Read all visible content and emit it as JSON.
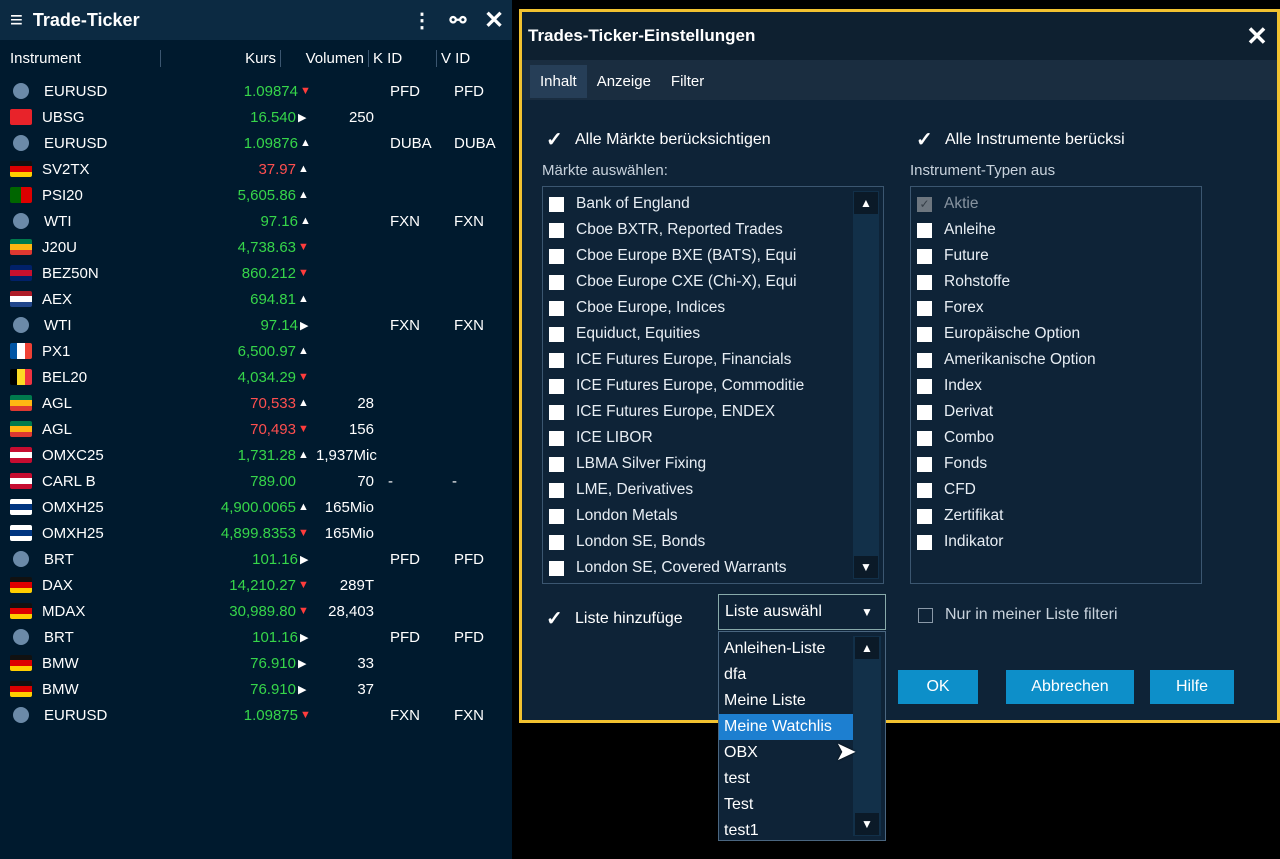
{
  "ticker": {
    "title": "Trade-Ticker",
    "columns": {
      "instrument": "Instrument",
      "kurs": "Kurs",
      "volumen": "Volumen",
      "kid": "K ID",
      "vid": "V ID"
    },
    "rows": [
      {
        "flag": "globe",
        "inst": "EURUSD",
        "kurs": "1.09874",
        "dir": "down",
        "color": "g",
        "vol": "",
        "kid": "PFD",
        "vid": "PFD"
      },
      {
        "flag": "ch",
        "inst": "UBSG",
        "kurs": "16.540",
        "dir": "right",
        "color": "g",
        "vol": "250",
        "kid": "",
        "vid": ""
      },
      {
        "flag": "globe",
        "inst": "EURUSD",
        "kurs": "1.09876",
        "dir": "up",
        "color": "g",
        "vol": "",
        "kid": "DUBA",
        "vid": "DUBA"
      },
      {
        "flag": "de",
        "inst": "SV2TX",
        "kurs": "37.97",
        "dir": "up",
        "color": "r",
        "vol": "",
        "kid": "",
        "vid": ""
      },
      {
        "flag": "pt",
        "inst": "PSI20",
        "kurs": "5,605.86",
        "dir": "up",
        "color": "g",
        "vol": "",
        "kid": "",
        "vid": ""
      },
      {
        "flag": "globe",
        "inst": "WTI",
        "kurs": "97.16",
        "dir": "up",
        "color": "g",
        "vol": "",
        "kid": "FXN",
        "vid": "FXN"
      },
      {
        "flag": "za",
        "inst": "J20U",
        "kurs": "4,738.63",
        "dir": "down",
        "color": "g",
        "vol": "",
        "kid": "",
        "vid": ""
      },
      {
        "flag": "gb",
        "inst": "BEZ50N",
        "kurs": "860.212",
        "dir": "down",
        "color": "g",
        "vol": "",
        "kid": "",
        "vid": ""
      },
      {
        "flag": "nl",
        "inst": "AEX",
        "kurs": "694.81",
        "dir": "up",
        "color": "g",
        "vol": "",
        "kid": "",
        "vid": ""
      },
      {
        "flag": "globe",
        "inst": "WTI",
        "kurs": "97.14",
        "dir": "right",
        "color": "g",
        "vol": "",
        "kid": "FXN",
        "vid": "FXN"
      },
      {
        "flag": "fr",
        "inst": "PX1",
        "kurs": "6,500.97",
        "dir": "up",
        "color": "g",
        "vol": "",
        "kid": "",
        "vid": ""
      },
      {
        "flag": "be",
        "inst": "BEL20",
        "kurs": "4,034.29",
        "dir": "down",
        "color": "g",
        "vol": "",
        "kid": "",
        "vid": ""
      },
      {
        "flag": "za",
        "inst": "AGL",
        "kurs": "70,533",
        "dir": "up",
        "color": "r",
        "vol": "28",
        "kid": "",
        "vid": ""
      },
      {
        "flag": "za",
        "inst": "AGL",
        "kurs": "70,493",
        "dir": "down",
        "color": "r",
        "vol": "156",
        "kid": "",
        "vid": ""
      },
      {
        "flag": "dk",
        "inst": "OMXC25",
        "kurs": "1,731.28",
        "dir": "up",
        "color": "g",
        "vol": "1,937Mic",
        "kid": "",
        "vid": ""
      },
      {
        "flag": "dk",
        "inst": "CARL B",
        "kurs": "789.00",
        "dir": "none",
        "color": "g",
        "vol": "70",
        "kid": "-",
        "vid": "-"
      },
      {
        "flag": "fi",
        "inst": "OMXH25",
        "kurs": "4,900.0065",
        "dir": "up",
        "color": "g",
        "vol": "165Mio",
        "kid": "",
        "vid": ""
      },
      {
        "flag": "fi",
        "inst": "OMXH25",
        "kurs": "4,899.8353",
        "dir": "down",
        "color": "g",
        "vol": "165Mio",
        "kid": "",
        "vid": ""
      },
      {
        "flag": "globe",
        "inst": "BRT",
        "kurs": "101.16",
        "dir": "right",
        "color": "g",
        "vol": "",
        "kid": "PFD",
        "vid": "PFD"
      },
      {
        "flag": "de",
        "inst": "DAX",
        "kurs": "14,210.27",
        "dir": "down",
        "color": "g",
        "vol": "289T",
        "kid": "",
        "vid": ""
      },
      {
        "flag": "de",
        "inst": "MDAX",
        "kurs": "30,989.80",
        "dir": "down",
        "color": "g",
        "vol": "28,403",
        "kid": "",
        "vid": ""
      },
      {
        "flag": "globe",
        "inst": "BRT",
        "kurs": "101.16",
        "dir": "right",
        "color": "g",
        "vol": "",
        "kid": "PFD",
        "vid": "PFD"
      },
      {
        "flag": "de",
        "inst": "BMW",
        "kurs": "76.910",
        "dir": "right",
        "color": "g",
        "vol": "33",
        "kid": "",
        "vid": ""
      },
      {
        "flag": "de",
        "inst": "BMW",
        "kurs": "76.910",
        "dir": "right",
        "color": "g",
        "vol": "37",
        "kid": "",
        "vid": ""
      },
      {
        "flag": "globe",
        "inst": "EURUSD",
        "kurs": "1.09875",
        "dir": "down",
        "color": "g",
        "vol": "",
        "kid": "FXN",
        "vid": "FXN"
      }
    ]
  },
  "dialog": {
    "title": "Trades-Ticker-Einstellungen",
    "tabs": [
      "Inhalt",
      "Anzeige",
      "Filter"
    ],
    "all_markets": "Alle Märkte berücksichtigen",
    "markets_label": "Märkte auswählen:",
    "markets": [
      "Bank of England",
      "Cboe BXTR, Reported Trades",
      "Cboe Europe BXE (BATS), Equi",
      "Cboe Europe CXE (Chi-X), Equi",
      "Cboe Europe, Indices",
      "Equiduct, Equities",
      "ICE Futures Europe,  Financials",
      "ICE Futures Europe, Commoditie",
      "ICE Futures Europe, ENDEX",
      "ICE LIBOR",
      "LBMA Silver Fixing",
      "LME, Derivatives",
      "London Metals",
      "London SE, Bonds",
      "London SE, Covered Warrants"
    ],
    "all_instruments": "Alle Instrumente berücksi",
    "types_label": "Instrument-Typen aus",
    "types": [
      "Aktie",
      "Anleihe",
      "Future",
      "Rohstoffe",
      "Forex",
      "Europäische Option",
      "Amerikanische Option",
      "Index",
      "Derivat",
      "Combo",
      "Fonds",
      "CFD",
      "Zertifikat",
      "Indikator"
    ],
    "list_add": "Liste hinzufüge",
    "list_select": "Liste auswähl",
    "only_my_list": "Nur in meiner Liste filteri",
    "ok": "OK",
    "cancel": "Abbrechen",
    "help": "Hilfe",
    "dropdown": [
      "Anleihen-Liste",
      "dfa",
      "Meine Liste",
      "Meine Watchlis",
      "OBX",
      "test",
      "Test",
      "test1"
    ]
  },
  "colors": {
    "accent": "#f2c230",
    "button": "#0d8fc9",
    "up": "#36d64a",
    "down": "#ff4f4f"
  }
}
